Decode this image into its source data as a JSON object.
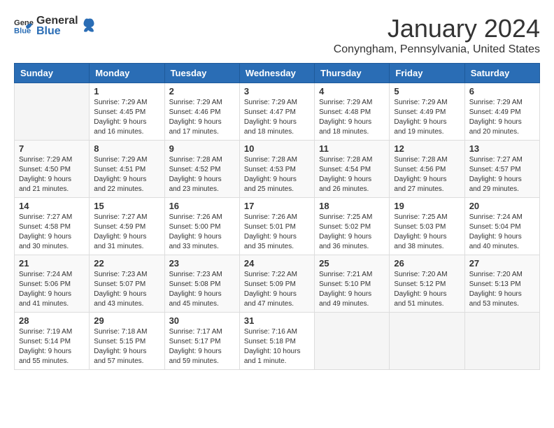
{
  "header": {
    "logo_general": "General",
    "logo_blue": "Blue",
    "month_year": "January 2024",
    "location": "Conyngham, Pennsylvania, United States"
  },
  "weekdays": [
    "Sunday",
    "Monday",
    "Tuesday",
    "Wednesday",
    "Thursday",
    "Friday",
    "Saturday"
  ],
  "weeks": [
    [
      {
        "day": "",
        "sunrise": "",
        "sunset": "",
        "daylight": ""
      },
      {
        "day": "1",
        "sunrise": "Sunrise: 7:29 AM",
        "sunset": "Sunset: 4:45 PM",
        "daylight": "Daylight: 9 hours and 16 minutes."
      },
      {
        "day": "2",
        "sunrise": "Sunrise: 7:29 AM",
        "sunset": "Sunset: 4:46 PM",
        "daylight": "Daylight: 9 hours and 17 minutes."
      },
      {
        "day": "3",
        "sunrise": "Sunrise: 7:29 AM",
        "sunset": "Sunset: 4:47 PM",
        "daylight": "Daylight: 9 hours and 18 minutes."
      },
      {
        "day": "4",
        "sunrise": "Sunrise: 7:29 AM",
        "sunset": "Sunset: 4:48 PM",
        "daylight": "Daylight: 9 hours and 18 minutes."
      },
      {
        "day": "5",
        "sunrise": "Sunrise: 7:29 AM",
        "sunset": "Sunset: 4:49 PM",
        "daylight": "Daylight: 9 hours and 19 minutes."
      },
      {
        "day": "6",
        "sunrise": "Sunrise: 7:29 AM",
        "sunset": "Sunset: 4:49 PM",
        "daylight": "Daylight: 9 hours and 20 minutes."
      }
    ],
    [
      {
        "day": "7",
        "sunrise": "Sunrise: 7:29 AM",
        "sunset": "Sunset: 4:50 PM",
        "daylight": "Daylight: 9 hours and 21 minutes."
      },
      {
        "day": "8",
        "sunrise": "Sunrise: 7:29 AM",
        "sunset": "Sunset: 4:51 PM",
        "daylight": "Daylight: 9 hours and 22 minutes."
      },
      {
        "day": "9",
        "sunrise": "Sunrise: 7:28 AM",
        "sunset": "Sunset: 4:52 PM",
        "daylight": "Daylight: 9 hours and 23 minutes."
      },
      {
        "day": "10",
        "sunrise": "Sunrise: 7:28 AM",
        "sunset": "Sunset: 4:53 PM",
        "daylight": "Daylight: 9 hours and 25 minutes."
      },
      {
        "day": "11",
        "sunrise": "Sunrise: 7:28 AM",
        "sunset": "Sunset: 4:54 PM",
        "daylight": "Daylight: 9 hours and 26 minutes."
      },
      {
        "day": "12",
        "sunrise": "Sunrise: 7:28 AM",
        "sunset": "Sunset: 4:56 PM",
        "daylight": "Daylight: 9 hours and 27 minutes."
      },
      {
        "day": "13",
        "sunrise": "Sunrise: 7:27 AM",
        "sunset": "Sunset: 4:57 PM",
        "daylight": "Daylight: 9 hours and 29 minutes."
      }
    ],
    [
      {
        "day": "14",
        "sunrise": "Sunrise: 7:27 AM",
        "sunset": "Sunset: 4:58 PM",
        "daylight": "Daylight: 9 hours and 30 minutes."
      },
      {
        "day": "15",
        "sunrise": "Sunrise: 7:27 AM",
        "sunset": "Sunset: 4:59 PM",
        "daylight": "Daylight: 9 hours and 31 minutes."
      },
      {
        "day": "16",
        "sunrise": "Sunrise: 7:26 AM",
        "sunset": "Sunset: 5:00 PM",
        "daylight": "Daylight: 9 hours and 33 minutes."
      },
      {
        "day": "17",
        "sunrise": "Sunrise: 7:26 AM",
        "sunset": "Sunset: 5:01 PM",
        "daylight": "Daylight: 9 hours and 35 minutes."
      },
      {
        "day": "18",
        "sunrise": "Sunrise: 7:25 AM",
        "sunset": "Sunset: 5:02 PM",
        "daylight": "Daylight: 9 hours and 36 minutes."
      },
      {
        "day": "19",
        "sunrise": "Sunrise: 7:25 AM",
        "sunset": "Sunset: 5:03 PM",
        "daylight": "Daylight: 9 hours and 38 minutes."
      },
      {
        "day": "20",
        "sunrise": "Sunrise: 7:24 AM",
        "sunset": "Sunset: 5:04 PM",
        "daylight": "Daylight: 9 hours and 40 minutes."
      }
    ],
    [
      {
        "day": "21",
        "sunrise": "Sunrise: 7:24 AM",
        "sunset": "Sunset: 5:06 PM",
        "daylight": "Daylight: 9 hours and 41 minutes."
      },
      {
        "day": "22",
        "sunrise": "Sunrise: 7:23 AM",
        "sunset": "Sunset: 5:07 PM",
        "daylight": "Daylight: 9 hours and 43 minutes."
      },
      {
        "day": "23",
        "sunrise": "Sunrise: 7:23 AM",
        "sunset": "Sunset: 5:08 PM",
        "daylight": "Daylight: 9 hours and 45 minutes."
      },
      {
        "day": "24",
        "sunrise": "Sunrise: 7:22 AM",
        "sunset": "Sunset: 5:09 PM",
        "daylight": "Daylight: 9 hours and 47 minutes."
      },
      {
        "day": "25",
        "sunrise": "Sunrise: 7:21 AM",
        "sunset": "Sunset: 5:10 PM",
        "daylight": "Daylight: 9 hours and 49 minutes."
      },
      {
        "day": "26",
        "sunrise": "Sunrise: 7:20 AM",
        "sunset": "Sunset: 5:12 PM",
        "daylight": "Daylight: 9 hours and 51 minutes."
      },
      {
        "day": "27",
        "sunrise": "Sunrise: 7:20 AM",
        "sunset": "Sunset: 5:13 PM",
        "daylight": "Daylight: 9 hours and 53 minutes."
      }
    ],
    [
      {
        "day": "28",
        "sunrise": "Sunrise: 7:19 AM",
        "sunset": "Sunset: 5:14 PM",
        "daylight": "Daylight: 9 hours and 55 minutes."
      },
      {
        "day": "29",
        "sunrise": "Sunrise: 7:18 AM",
        "sunset": "Sunset: 5:15 PM",
        "daylight": "Daylight: 9 hours and 57 minutes."
      },
      {
        "day": "30",
        "sunrise": "Sunrise: 7:17 AM",
        "sunset": "Sunset: 5:17 PM",
        "daylight": "Daylight: 9 hours and 59 minutes."
      },
      {
        "day": "31",
        "sunrise": "Sunrise: 7:16 AM",
        "sunset": "Sunset: 5:18 PM",
        "daylight": "Daylight: 10 hours and 1 minute."
      },
      {
        "day": "",
        "sunrise": "",
        "sunset": "",
        "daylight": ""
      },
      {
        "day": "",
        "sunrise": "",
        "sunset": "",
        "daylight": ""
      },
      {
        "day": "",
        "sunrise": "",
        "sunset": "",
        "daylight": ""
      }
    ]
  ]
}
